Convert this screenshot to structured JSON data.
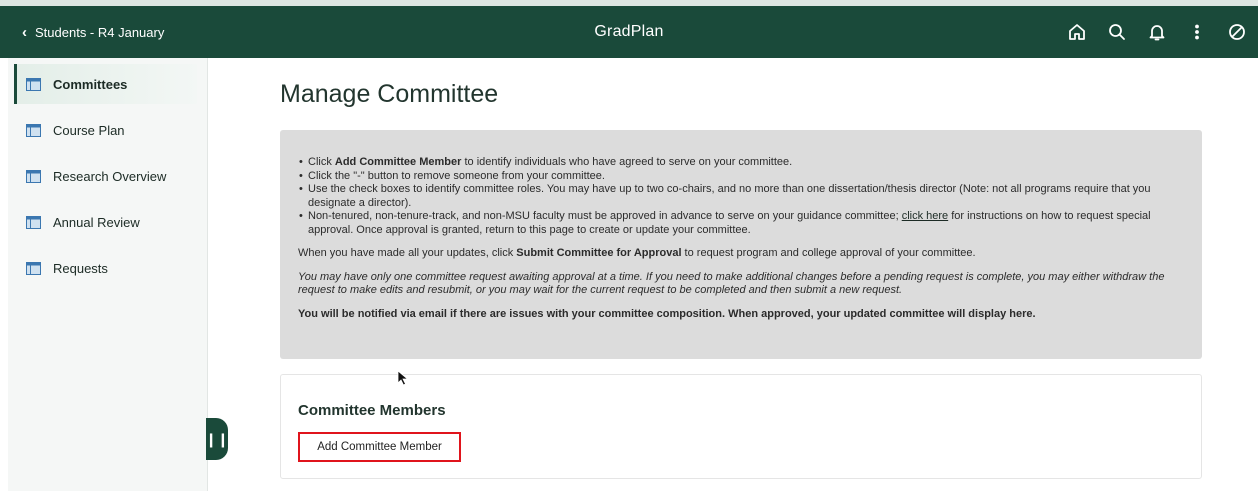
{
  "topbar": {
    "back_label": "Students - R4 January",
    "app_title": "GradPlan",
    "actions": [
      "home-icon",
      "search-icon",
      "bell-icon",
      "more-vertical-icon",
      "blocked-icon"
    ]
  },
  "sidebar": {
    "items": [
      {
        "label": "Committees",
        "active": true
      },
      {
        "label": "Course Plan",
        "active": false
      },
      {
        "label": "Research Overview",
        "active": false
      },
      {
        "label": "Annual Review",
        "active": false
      },
      {
        "label": "Requests",
        "active": false
      }
    ]
  },
  "main": {
    "title": "Manage Committee",
    "info": {
      "b1_pre": "Click ",
      "b1_bold": "Add Committee Member",
      "b1_post": " to identify individuals who have agreed to serve on your committee.",
      "b2": "Click the \"-\" button to remove someone from your committee.",
      "b3": "Use the check boxes to identify committee roles. You may have up to two co-chairs, and no more than one dissertation/thesis director (Note: not all programs require that you designate a director).",
      "b4_pre": "Non-tenured, non-tenure-track, and non-MSU faculty must be approved in advance to serve on your guidance committee; ",
      "b4_link": "click here",
      "b4_post": " for instructions on how to request special approval. Once approval is granted, return to this page to create or update your committee.",
      "p1_pre": "When you have made all your updates, click ",
      "p1_bold": "Submit Committee for Approval",
      "p1_post": " to request program and college approval of your committee.",
      "p2": "You may have only one committee request awaiting approval at a time. If you need to make additional changes before a pending request is complete, you may either withdraw the request to make edits and resubmit, or you may wait for the current request to be completed and then submit a new request.",
      "p3": "You will be notified via email if there are issues with your committee composition. When approved, your updated committee will display here."
    },
    "members": {
      "title": "Committee Members",
      "add_button": "Add Committee Member"
    }
  },
  "colors": {
    "brand_green": "#1a4a3a",
    "highlight_red": "#e0141c",
    "info_bg": "#dcdcdc"
  }
}
